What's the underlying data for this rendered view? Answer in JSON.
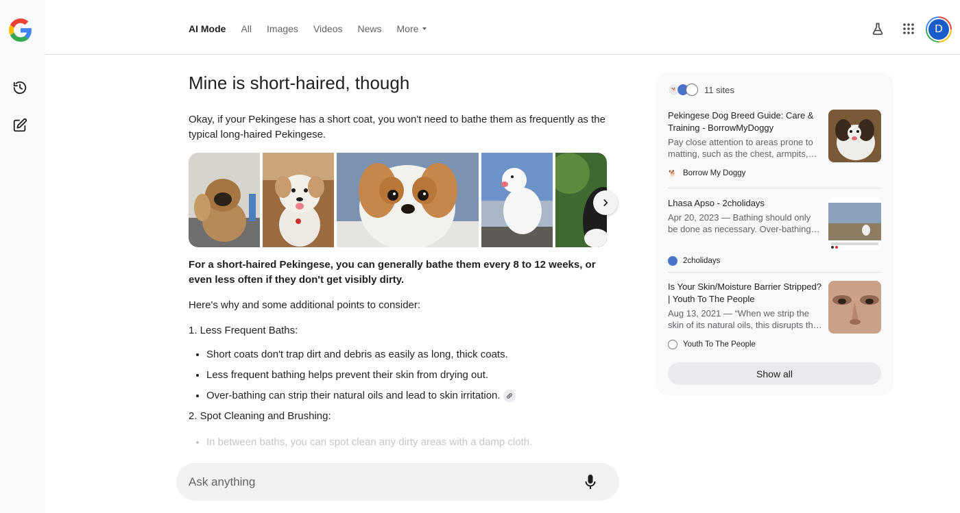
{
  "header": {
    "tabs": [
      {
        "label": "AI Mode",
        "active": true
      },
      {
        "label": "All"
      },
      {
        "label": "Images"
      },
      {
        "label": "Videos"
      },
      {
        "label": "News"
      },
      {
        "label": "More"
      }
    ],
    "avatar_letter": "D"
  },
  "rail": {
    "icons": [
      "google-logo",
      "history-icon",
      "new-chat-icon"
    ]
  },
  "main": {
    "query_title": "Mine is short-haired, though",
    "intro": "Okay, if your Pekingese has a short coat, you won't need to bathe them as frequently as the typical long-haired Pekingese.",
    "gallery_images": [
      "pekingese-shaggy-photo",
      "pekingese-white-tongue-photo",
      "pekingese-closeup-photo",
      "pekingese-white-outdoor-photo",
      "dog-black-white-photo"
    ],
    "lead": "For a short-haired Pekingese, you can generally bathe them every 8 to 12 weeks, or even less often if they don't get visibly dirty.",
    "why": "Here's why and some additional points to consider:",
    "section1": "1. Less Frequent Baths:",
    "bullets": [
      "Short coats don't trap dirt and debris as easily as long, thick coats.",
      "Less frequent bathing helps prevent their skin from drying out.",
      "Over-bathing can strip their natural oils and lead to skin irritation."
    ],
    "section2": "2. Spot Cleaning and Brushing:",
    "faded_bullet": "In between baths, you can spot clean any dirty areas with a damp cloth."
  },
  "ask": {
    "placeholder": "Ask anything"
  },
  "sources": {
    "count_label": "11 sites",
    "cards": [
      {
        "title": "Pekingese Dog Breed Guide: Care & Training - BorrowMyDoggy",
        "snippet": "Pay close attention to areas prone to matting, such as the chest, armpits, and behind the ears.",
        "source": "Borrow My Doggy"
      },
      {
        "title": "Lhasa Apso - 2cholidays",
        "snippet": "Apr 20, 2023 — Bathing should only be done as necessary. Over-bathing can strip natural oils.",
        "source": "2cholidays"
      },
      {
        "title": "Is Your Skin/Moisture Barrier Stripped? | Youth To The People",
        "snippet": "Aug 13, 2021 — “When we strip the skin of its natural oils, this disrupts the moisture barrier.",
        "source": "Youth To The People"
      }
    ],
    "show_all_label": "Show all"
  },
  "colors": {
    "accent_blue": "#1a5cc8",
    "panel_bg": "#f8f9fa",
    "text_primary": "#1f1f1f",
    "text_secondary": "#5f6368"
  }
}
